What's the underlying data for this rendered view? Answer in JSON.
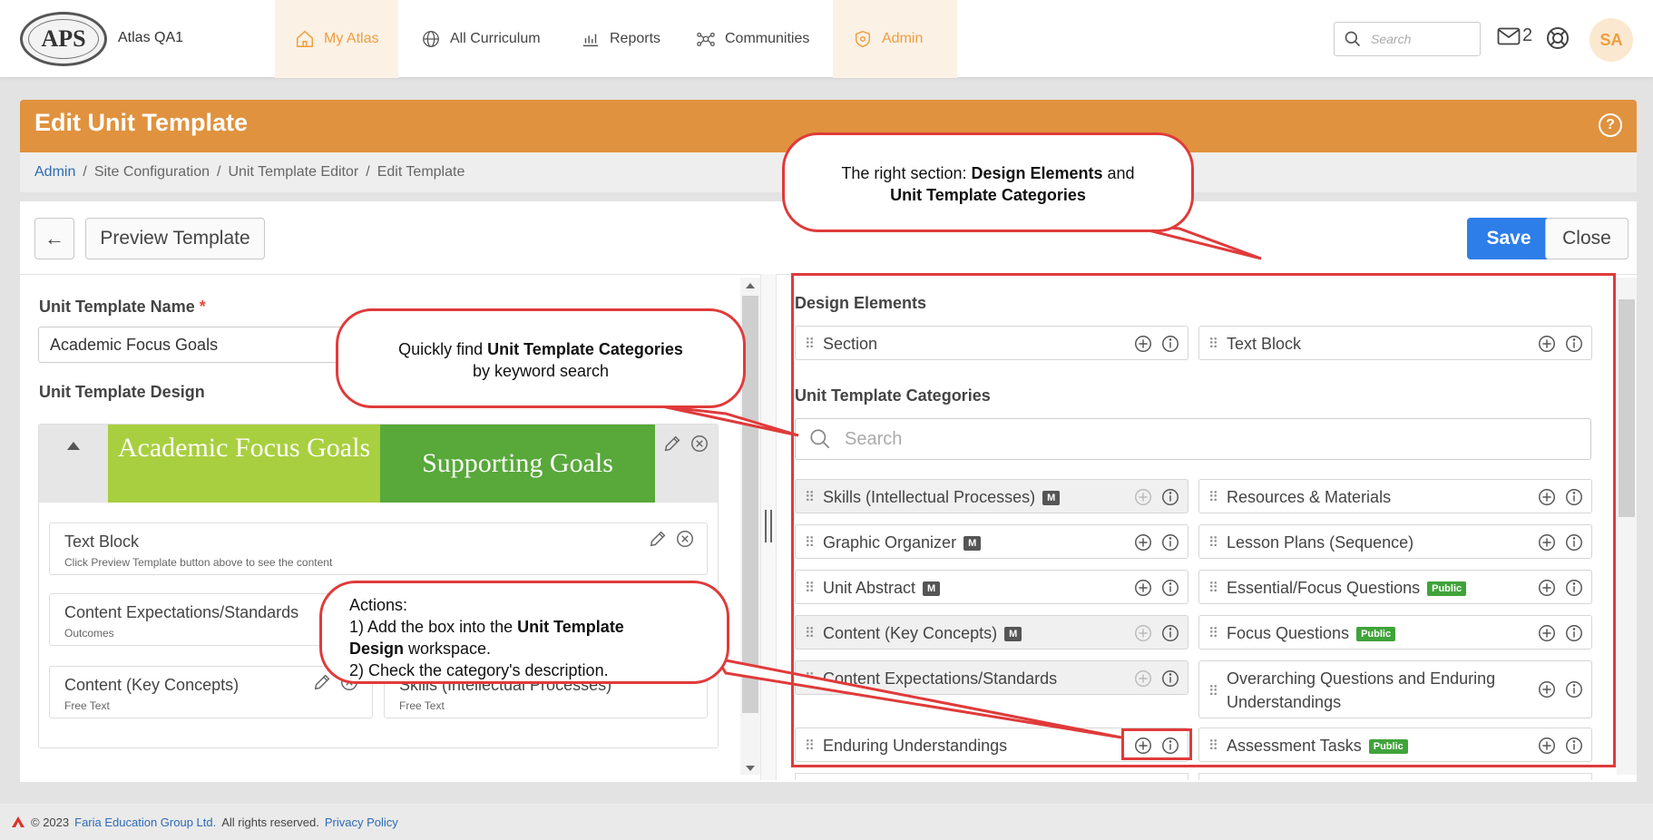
{
  "app": {
    "name": "Atlas QA1",
    "logo_text": "APS"
  },
  "nav": {
    "items": [
      {
        "label": "My Atlas",
        "icon": "home-icon"
      },
      {
        "label": "All Curriculum",
        "icon": "globe-icon"
      },
      {
        "label": "Reports",
        "icon": "bar-chart-icon"
      },
      {
        "label": "Communities",
        "icon": "network-icon"
      },
      {
        "label": "Admin",
        "icon": "shield-icon"
      }
    ],
    "search_placeholder": "Search",
    "mail_count": "2",
    "avatar": "SA"
  },
  "header": {
    "title": "Edit Unit Template",
    "help": "?"
  },
  "breadcrumb": {
    "items": [
      "Admin",
      "Site Configuration",
      "Unit Template Editor",
      "Edit Template"
    ],
    "sep": "/"
  },
  "toolbar": {
    "back": "←",
    "preview": "Preview Template",
    "save": "Save",
    "close": "Close"
  },
  "left": {
    "name_label": "Unit Template Name",
    "required_mark": "*",
    "name_value": "Academic Focus Goals",
    "design_label": "Unit Template Design",
    "tabs": [
      "Academic Focus Goals",
      "Supporting Goals"
    ],
    "cards": [
      {
        "title": "Text Block",
        "sub": "Click Preview Template button above to see the content"
      },
      {
        "title": "Content Expectations/Standards",
        "sub": "Outcomes"
      },
      {
        "title": "Content (Key Concepts)",
        "sub": "Free Text"
      },
      {
        "title": "Skills (Intellectual Processes)",
        "sub": "Free Text"
      }
    ]
  },
  "right": {
    "design_elements_label": "Design Elements",
    "design_elements": [
      "Section",
      "Text Block"
    ],
    "categories_label": "Unit Template Categories",
    "search_placeholder": "Search",
    "categories_left": [
      {
        "label": "Skills (Intellectual Processes)",
        "badge": "M"
      },
      {
        "label": "Graphic Organizer",
        "badge": "M"
      },
      {
        "label": "Unit Abstract",
        "badge": "M"
      },
      {
        "label": "Content (Key Concepts)",
        "badge": "M"
      },
      {
        "label": "Content Expectations/Standards",
        "badge": ""
      },
      {
        "label": "Enduring Understandings",
        "badge": ""
      }
    ],
    "categories_right": [
      {
        "label": "Resources & Materials",
        "badge": ""
      },
      {
        "label": "Lesson Plans (Sequence)",
        "badge": ""
      },
      {
        "label": "Essential/Focus Questions",
        "badge": "Public"
      },
      {
        "label": "Focus Questions",
        "badge": "Public"
      },
      {
        "label": "Overarching Questions and Enduring",
        "label2": "Understandings",
        "badge": ""
      },
      {
        "label": "Assessment Tasks",
        "badge": "Public"
      }
    ]
  },
  "callouts": {
    "right": {
      "pre": "The right section: ",
      "b1": "Design Elements",
      "mid": " and",
      "b2": "Unit Template Categories"
    },
    "search": {
      "pre": "Quickly find ",
      "b": "Unit Template Categories",
      "post": "by keyword search"
    },
    "actions": {
      "title": "Actions:",
      "l1a": "1) Add the box into the ",
      "l1b": "Unit Template",
      "l2a": "Design",
      "l2b": " workspace.",
      "l3": "2) Check the category's description."
    }
  },
  "footer": {
    "pre": "© 2023",
    "company": "Faria Education Group Ltd.",
    "rights": "All rights reserved.",
    "privacy": "Privacy Policy"
  }
}
